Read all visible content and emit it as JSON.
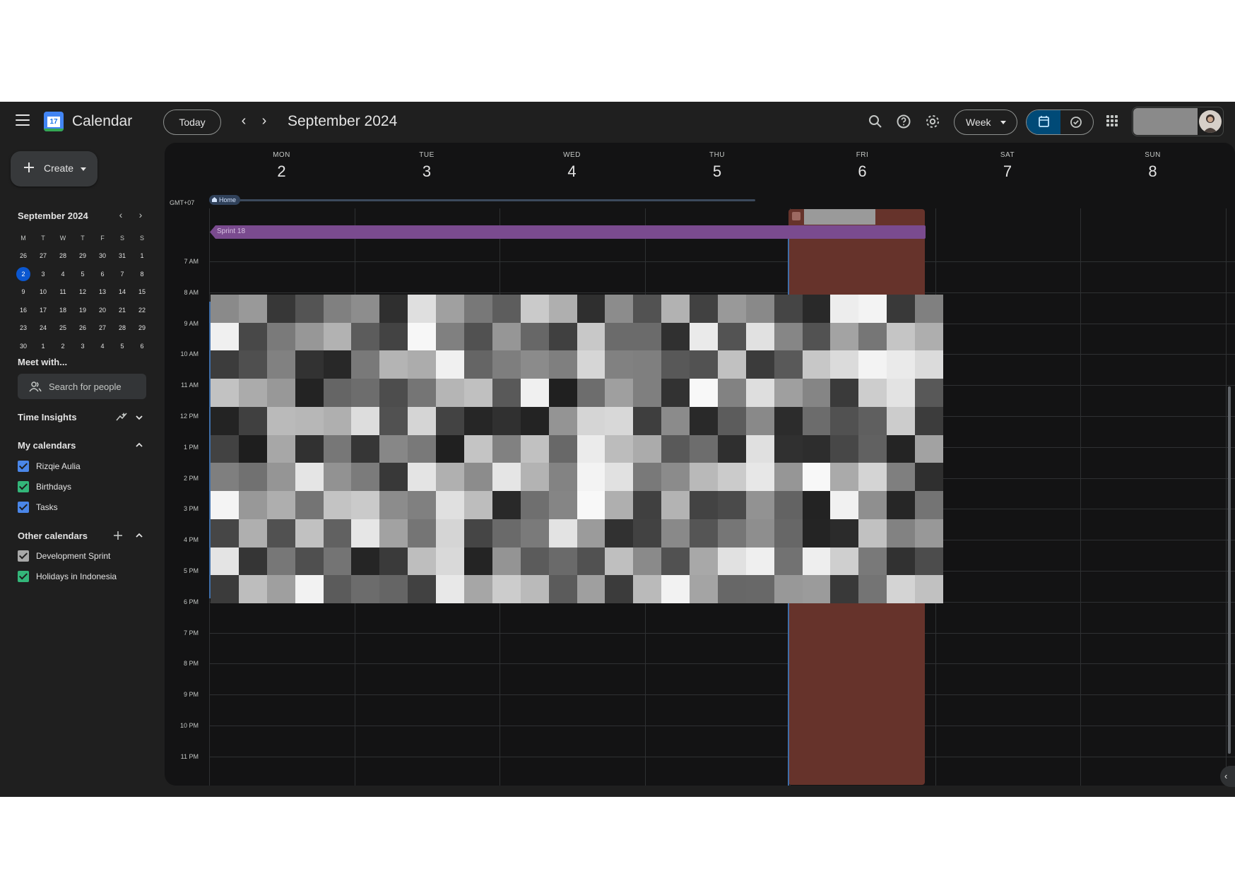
{
  "header": {
    "app_title": "Calendar",
    "logo_text": "17",
    "today_label": "Today",
    "month_title": "September 2024",
    "view_label": "Week"
  },
  "sidebar": {
    "create_label": "Create",
    "mini_calendar": {
      "title": "September 2024",
      "weekday_heads": [
        "M",
        "T",
        "W",
        "T",
        "F",
        "S",
        "S"
      ],
      "weeks": [
        [
          "26",
          "27",
          "28",
          "29",
          "30",
          "31",
          "1"
        ],
        [
          "2",
          "3",
          "4",
          "5",
          "6",
          "7",
          "8"
        ],
        [
          "9",
          "10",
          "11",
          "12",
          "13",
          "14",
          "15"
        ],
        [
          "16",
          "17",
          "18",
          "19",
          "20",
          "21",
          "22"
        ],
        [
          "23",
          "24",
          "25",
          "26",
          "27",
          "28",
          "29"
        ],
        [
          "30",
          "1",
          "2",
          "3",
          "4",
          "5",
          "6"
        ]
      ],
      "selected": "2"
    },
    "meet_title": "Meet with...",
    "search_people_placeholder": "Search for people",
    "time_insights_title": "Time Insights",
    "my_calendars_title": "My calendars",
    "my_calendars": [
      {
        "label": "Rizqie Aulia",
        "color": "#4a86e8"
      },
      {
        "label": "Birthdays",
        "color": "#33b679"
      },
      {
        "label": "Tasks",
        "color": "#4a86e8"
      }
    ],
    "other_calendars_title": "Other calendars",
    "other_calendars": [
      {
        "label": "Development Sprint",
        "color": "#a8a8a8"
      },
      {
        "label": "Holidays in Indonesia",
        "color": "#33b679"
      }
    ]
  },
  "week": {
    "timezone": "GMT+07",
    "days": [
      {
        "name": "MON",
        "num": "2"
      },
      {
        "name": "TUE",
        "num": "3"
      },
      {
        "name": "WED",
        "num": "4"
      },
      {
        "name": "THU",
        "num": "5"
      },
      {
        "name": "FRI",
        "num": "6"
      },
      {
        "name": "SAT",
        "num": "7"
      },
      {
        "name": "SUN",
        "num": "8"
      }
    ],
    "hours": [
      "7 AM",
      "8 AM",
      "9 AM",
      "10 AM",
      "11 AM",
      "12 PM",
      "1 PM",
      "2 PM",
      "3 PM",
      "4 PM",
      "5 PM",
      "6 PM",
      "7 PM",
      "8 PM",
      "9 PM",
      "10 PM",
      "11 PM"
    ],
    "events": {
      "home_label": "Home",
      "sprint_label": "Sprint 18"
    }
  },
  "colors": {
    "accent": "#0b57d0",
    "fri_event": "#66332b",
    "sprint": "#7a4b8f"
  }
}
